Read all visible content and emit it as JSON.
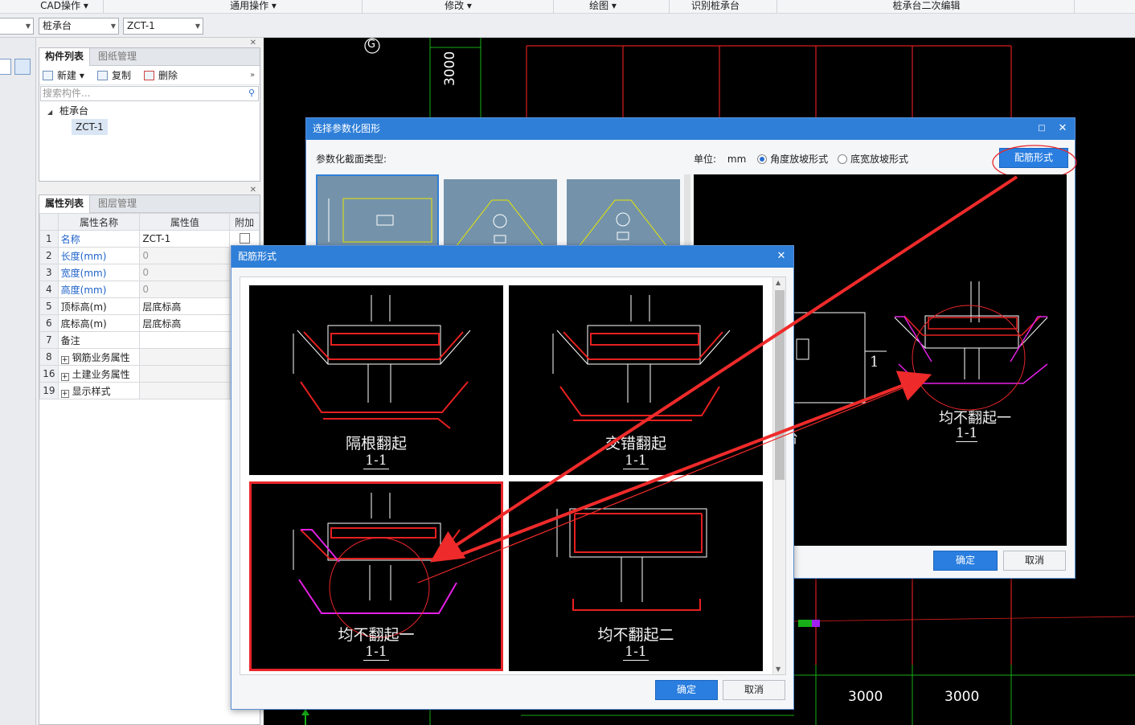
{
  "menu": {
    "items": [
      {
        "label": "CAD操作"
      },
      {
        "label": "通用操作"
      },
      {
        "label": "修改"
      },
      {
        "label": "绘图"
      },
      {
        "label": "识别桩承台"
      },
      {
        "label": "桩承台二次编辑"
      }
    ]
  },
  "combos": {
    "type_value": "桩承台",
    "name_value": "ZCT-1"
  },
  "component_panel": {
    "tabs": [
      "构件列表",
      "图纸管理"
    ],
    "new_label": "新建",
    "copy_label": "复制",
    "delete_label": "删除",
    "search_placeholder": "搜索构件...",
    "tree_root": "桩承台",
    "tree_child": "ZCT-1"
  },
  "property_panel": {
    "tabs": [
      "属性列表",
      "图层管理"
    ],
    "headers": [
      "属性名称",
      "属性值",
      "附加"
    ],
    "rows": [
      {
        "num": "1",
        "name": "名称",
        "value": "ZCT-1"
      },
      {
        "num": "2",
        "name": "长度(mm)",
        "value": "0"
      },
      {
        "num": "3",
        "name": "宽度(mm)",
        "value": "0"
      },
      {
        "num": "4",
        "name": "高度(mm)",
        "value": "0"
      },
      {
        "num": "5",
        "name": "顶标高(m)",
        "value": "层底标高"
      },
      {
        "num": "6",
        "name": "底标高(m)",
        "value": "层底标高"
      },
      {
        "num": "7",
        "name": "备注",
        "value": ""
      },
      {
        "num": "8",
        "name": "钢筋业务属性",
        "value": ""
      },
      {
        "num": "16",
        "name": "土建业务属性",
        "value": ""
      },
      {
        "num": "19",
        "name": "显示样式",
        "value": ""
      }
    ]
  },
  "cad": {
    "axis_label": "G",
    "dim_top": "3000",
    "dim_bottom_1": "3000",
    "dim_bottom_2": "3000"
  },
  "param_dialog": {
    "title": "选择参数化图形",
    "section_type_label": "参数化截面类型:",
    "unit_label": "单位:",
    "unit_value": "mm",
    "radio_1": "角度放坡形式",
    "radio_2": "底宽放坡形式",
    "rebar_button": "配筋形式",
    "preview_caption": "均不翻起一",
    "preview_sub": "1-1",
    "preview_side": "1",
    "preview_partial": "台",
    "ok": "确定",
    "cancel": "取消"
  },
  "rebar_dialog": {
    "title": "配筋形式",
    "options": [
      {
        "caption": "隔根翻起",
        "sub": "1-1"
      },
      {
        "caption": "交错翻起",
        "sub": "1-1"
      },
      {
        "caption": "均不翻起一",
        "sub": "1-1"
      },
      {
        "caption": "均不翻起二",
        "sub": "1-1"
      }
    ],
    "ok": "确定",
    "cancel": "取消"
  },
  "colors": {
    "accent": "#2a7ee0",
    "highlight": "#e8262a",
    "cad_red": "#d81e1e",
    "cad_green": "#18b018"
  }
}
